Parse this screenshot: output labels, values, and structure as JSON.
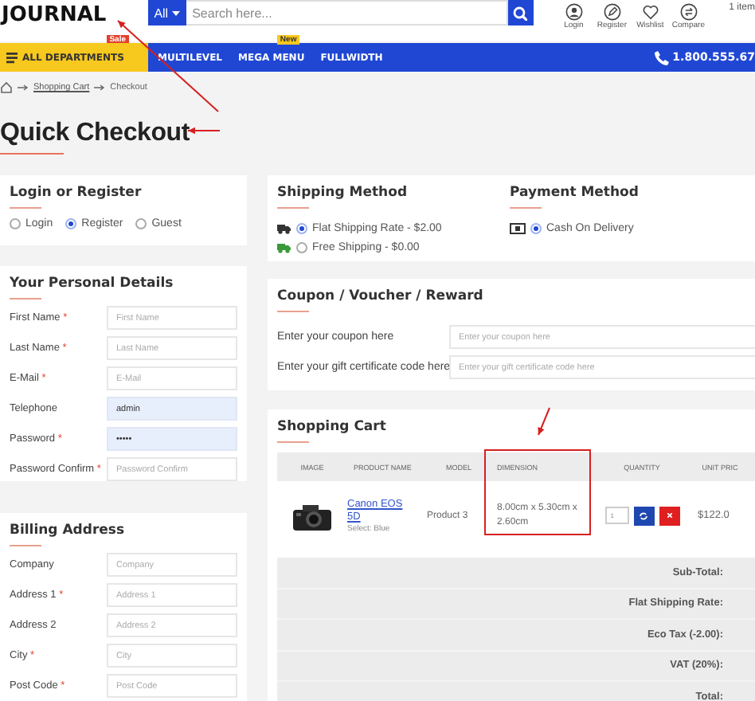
{
  "header": {
    "logo": "JOURNAL",
    "search": {
      "category": "All",
      "placeholder": "Search here..."
    },
    "actions": [
      {
        "label": "Login"
      },
      {
        "label": "Register"
      },
      {
        "label": "Wishlist"
      },
      {
        "label": "Compare"
      }
    ],
    "cart": "1 item"
  },
  "nav": {
    "departments": {
      "label": "ALL DEPARTMENTS",
      "badge": "Sale"
    },
    "items": [
      {
        "label": "MULTILEVEL"
      },
      {
        "label": "MEGA MENU",
        "badge": "New"
      },
      {
        "label": "FULLWIDTH"
      }
    ],
    "phone": "1.800.555.67"
  },
  "breadcrumb": [
    "Shopping Cart",
    "Checkout"
  ],
  "page_title": "Quick Checkout",
  "login_register": {
    "title": "Login or Register",
    "options": [
      {
        "label": "Login",
        "selected": false
      },
      {
        "label": "Register",
        "selected": true
      },
      {
        "label": "Guest",
        "selected": false
      }
    ]
  },
  "personal_details": {
    "title": "Your Personal Details",
    "fields": [
      {
        "label": "First Name",
        "required_mark": "*",
        "placeholder": "First Name",
        "autofilled": false
      },
      {
        "label": "Last Name",
        "required_mark": "*",
        "placeholder": "Last Name",
        "autofilled": false
      },
      {
        "label": "E-Mail",
        "required_mark": "*",
        "placeholder": "E-Mail",
        "autofilled": false
      },
      {
        "label": "Telephone",
        "value": "admin",
        "autofilled": true
      },
      {
        "label": "Password",
        "required_mark": "*",
        "value": "•••••",
        "autofilled": true
      },
      {
        "label": "Password Confirm",
        "required_mark": "*",
        "placeholder": "Password Confirm",
        "autofilled": false
      }
    ]
  },
  "billing_address": {
    "title": "Billing Address",
    "fields": [
      {
        "label": "Company",
        "placeholder": "Company",
        "autofilled": false
      },
      {
        "label": "Address 1",
        "required_mark": "*",
        "placeholder": "Address 1",
        "autofilled": false
      },
      {
        "label": "Address 2",
        "placeholder": "Address 2",
        "autofilled": false
      },
      {
        "label": "City",
        "required_mark": "*",
        "placeholder": "City",
        "autofilled": false
      },
      {
        "label": "Post Code",
        "required_mark": "*",
        "placeholder": "Post Code",
        "autofilled": false
      }
    ]
  },
  "shipping_method": {
    "title": "Shipping Method",
    "options": [
      {
        "label": "Flat Shipping Rate - $2.00",
        "selected": true
      },
      {
        "label": "Free Shipping - $0.00",
        "selected": false
      }
    ]
  },
  "payment_method": {
    "title": "Payment Method",
    "options": [
      {
        "label": "Cash On Delivery",
        "selected": true
      }
    ]
  },
  "coupon": {
    "title": "Coupon / Voucher / Reward",
    "fields": [
      {
        "label": "Enter your coupon here",
        "placeholder": "Enter your coupon here"
      },
      {
        "label": "Enter your gift certificate code here",
        "placeholder": "Enter your gift certificate code here"
      }
    ]
  },
  "cart": {
    "title": "Shopping Cart",
    "columns": [
      "IMAGE",
      "PRODUCT NAME",
      "MODEL",
      "DIMENSION",
      "QUANTITY",
      "UNIT PRIC"
    ],
    "rows": [
      {
        "name": "Canon EOS 5D",
        "option": "Select: Blue",
        "model": "Product 3",
        "dimension": "8.00cm x 5.30cm x 2.60cm",
        "quantity": "1",
        "unit_price": "$122.0"
      }
    ],
    "totals": [
      "Sub-Total:",
      "Flat Shipping Rate:",
      "Eco Tax (-2.00):",
      "VAT (20%):",
      "Total:"
    ]
  },
  "annotations": [
    {
      "kind": "arrow"
    },
    {
      "kind": "arrow"
    },
    {
      "kind": "box"
    },
    {
      "kind": "arrow"
    }
  ]
}
